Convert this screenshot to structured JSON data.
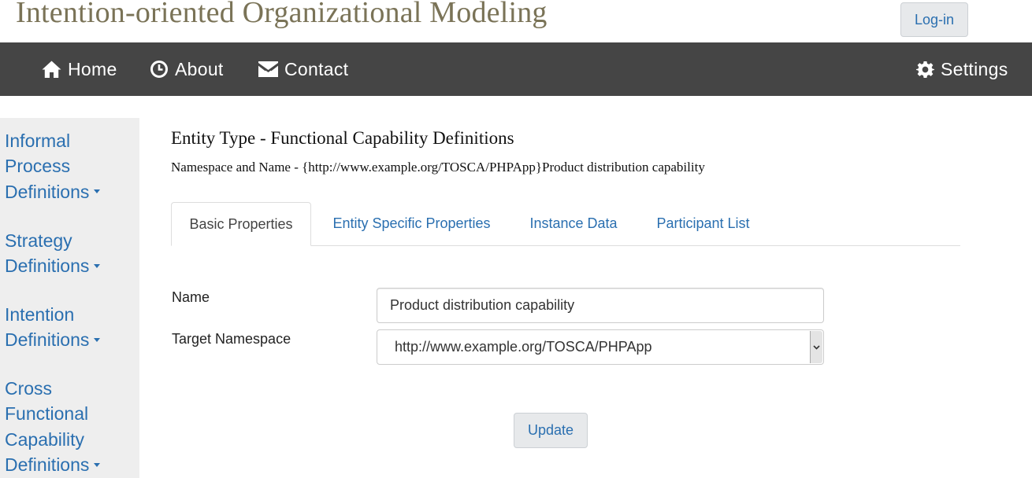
{
  "header": {
    "title": "Intention-oriented Organizational Modeling",
    "login_label": "Log-in"
  },
  "nav": {
    "home": "Home",
    "about": "About",
    "contact": "Contact",
    "settings": "Settings",
    "icons": [
      "home-icon",
      "clock-icon",
      "envelope-icon",
      "gear-icon"
    ]
  },
  "sidebar": {
    "items": [
      {
        "label": "Informal Process Definitions"
      },
      {
        "label": "Strategy Definitions"
      },
      {
        "label": "Intention Definitions"
      },
      {
        "label": "Cross Functional Capability Definitions"
      }
    ]
  },
  "main": {
    "heading": "Entity Type - Functional Capability Definitions",
    "namespace_line": "Namespace and Name - {http://www.example.org/TOSCA/PHPApp}Product distribution capability",
    "tabs": [
      {
        "label": "Basic Properties",
        "active": true
      },
      {
        "label": "Entity Specific Properties",
        "active": false
      },
      {
        "label": "Instance Data",
        "active": false
      },
      {
        "label": "Participant List",
        "active": false
      }
    ],
    "form": {
      "name_label": "Name",
      "name_value": "Product distribution capability",
      "namespace_label": "Target Namespace",
      "namespace_value": "http://www.example.org/TOSCA/PHPApp",
      "update_label": "Update"
    }
  },
  "colors": {
    "title": "#7a7357",
    "navbar": "#454545",
    "link": "#2a6fb0",
    "sidebar_bg": "#eeeeee",
    "button_bg": "#e7e9eb"
  }
}
